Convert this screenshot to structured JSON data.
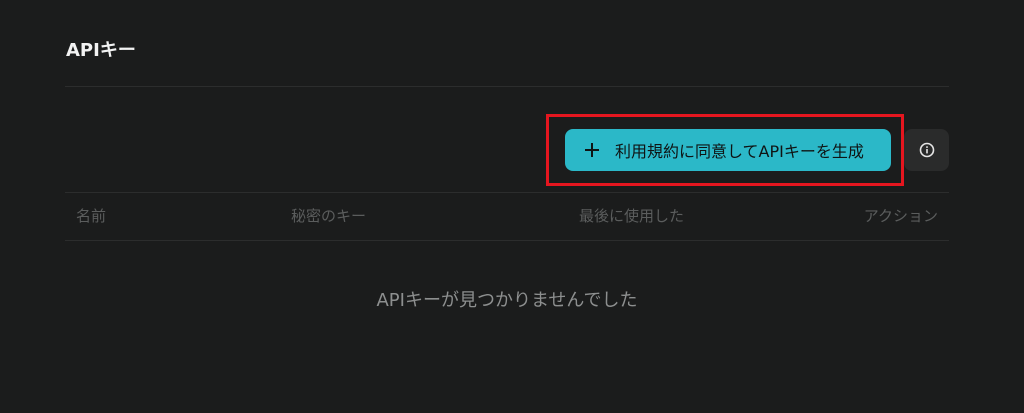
{
  "page": {
    "title": "APIキー"
  },
  "toolbar": {
    "create_button_label": "利用規約に同意してAPIキーを生成",
    "create_button_icon": "plus-icon",
    "info_icon": "info-icon",
    "accent_color": "#2bb8c8",
    "highlight_color": "#e5161f"
  },
  "table": {
    "columns": [
      "名前",
      "秘密のキー",
      "最後に使用した",
      "アクション"
    ],
    "empty_message": "APIキーが見つかりませんでした"
  }
}
